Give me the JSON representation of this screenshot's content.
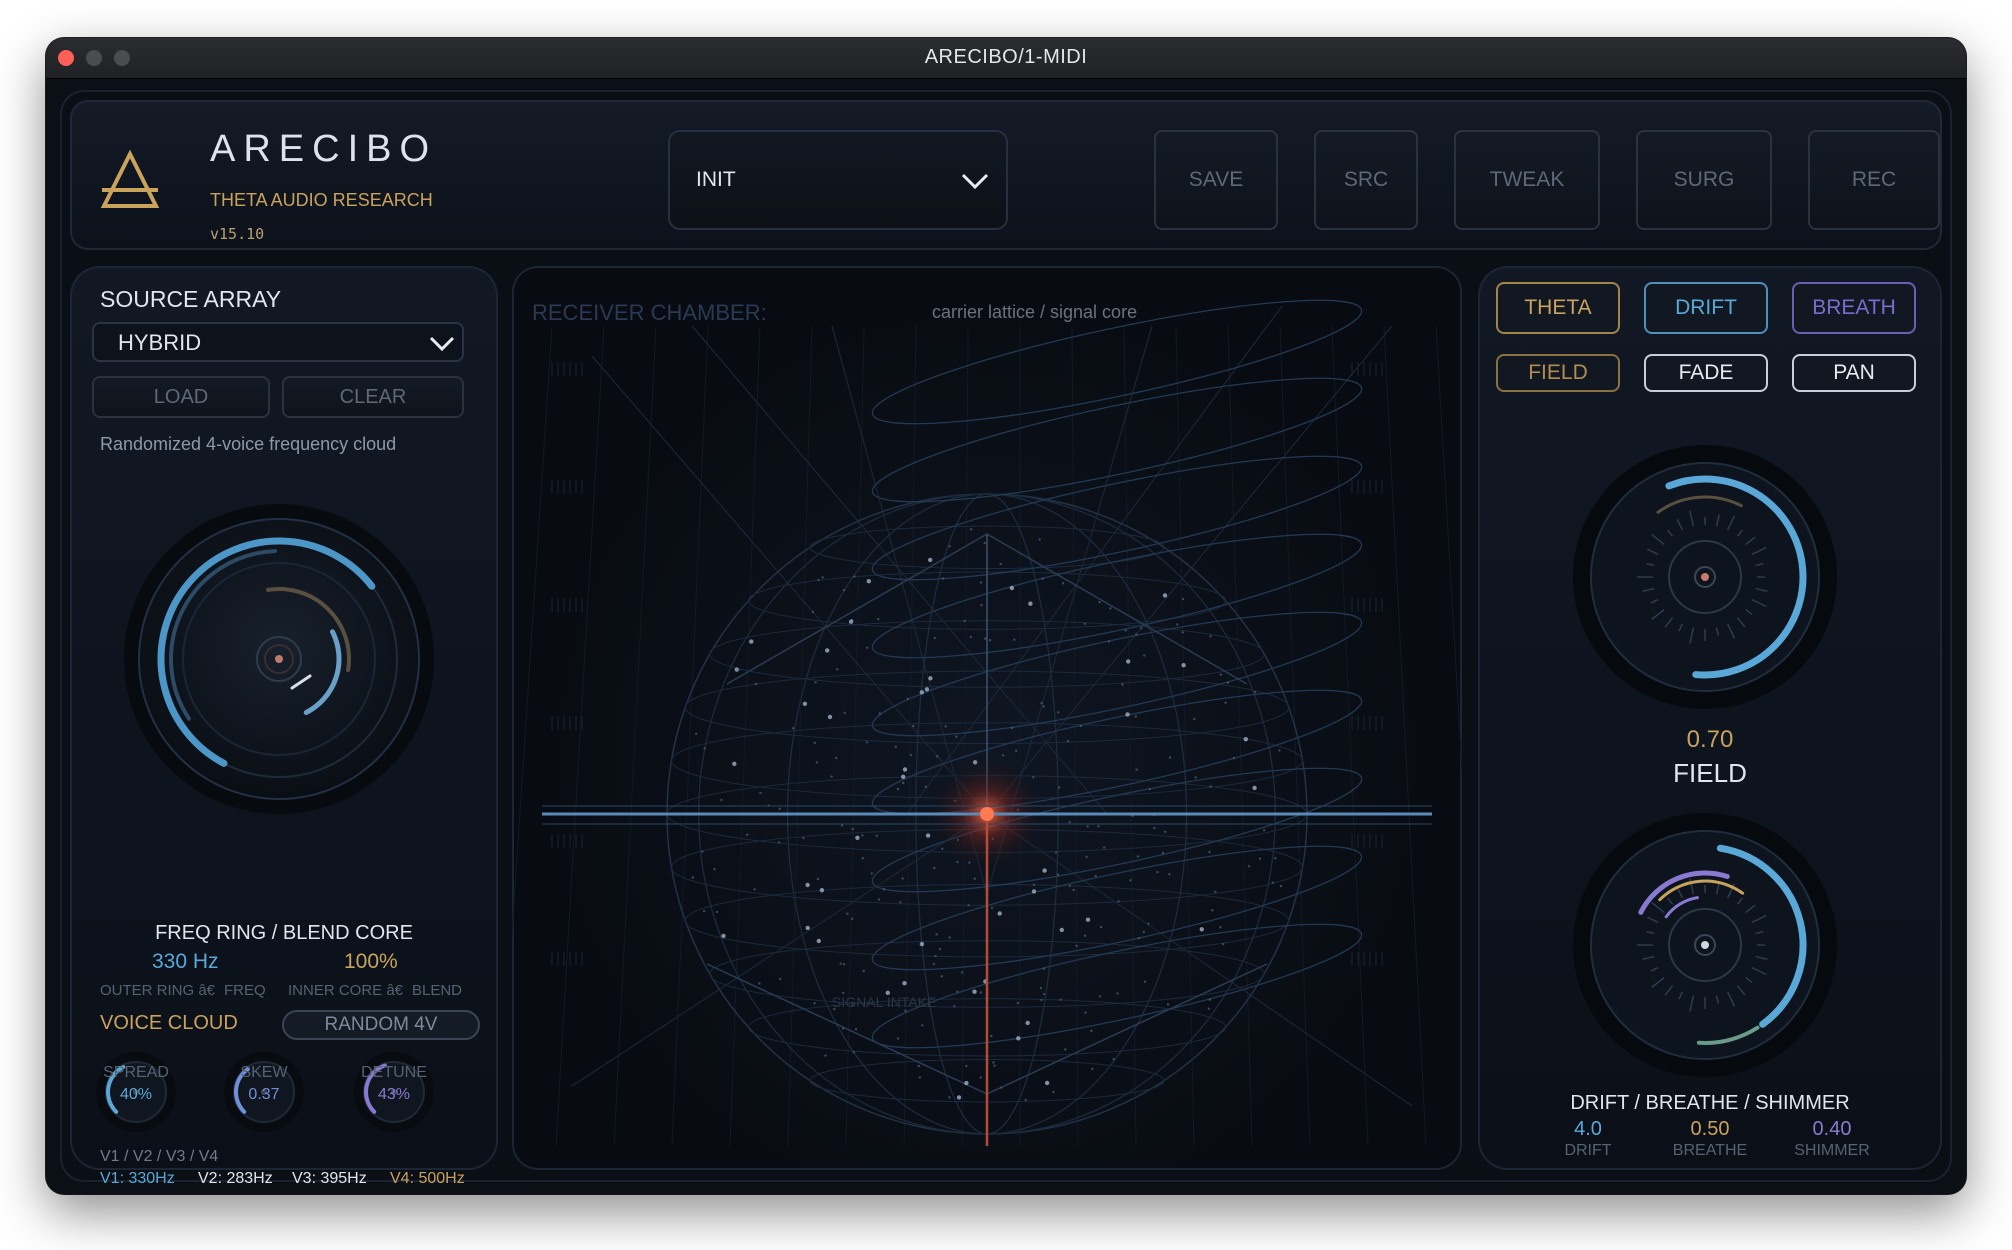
{
  "window": {
    "title": "ARECIBO/1-MIDI"
  },
  "header": {
    "brand": "ARECIBO",
    "subtitle": "THETA AUDIO RESEARCH",
    "version": "v15.10",
    "preset": "INIT",
    "buttons": [
      "SAVE",
      "SRC",
      "TWEAK",
      "SURG",
      "REC"
    ]
  },
  "source": {
    "title": "SOURCE ARRAY",
    "mode": "HYBRID",
    "load": "LOAD",
    "clear": "CLEAR",
    "description": "Randomized 4-voice frequency cloud",
    "dial_title": "FREQ RING / BLEND CORE",
    "freq_value": "330 Hz",
    "blend_value": "100%",
    "outer_label": "OUTER RING â€",
    "outer_param": "FREQ",
    "inner_label": "INNER CORE â€",
    "inner_param": "BLEND",
    "freq_level": 0.72,
    "blend_level": 1.0,
    "voice_title": "VOICE CLOUD",
    "random_button": "RANDOM 4V",
    "knobs": [
      {
        "label": "SPREAD",
        "value": "40%",
        "level": 0.4,
        "color": "#5aa8d8"
      },
      {
        "label": "SKEW",
        "value": "0.37",
        "level": 0.37,
        "color": "#6f8fd8"
      },
      {
        "label": "DETUNE",
        "value": "43%",
        "level": 0.43,
        "color": "#8a79d0"
      }
    ],
    "voices_header": "V1 / V2 / V3 / V4",
    "voices": [
      "V1: 330Hz",
      "V2: 283Hz",
      "V3: 395Hz",
      "V4: 500Hz"
    ]
  },
  "chamber": {
    "title": "RECEIVER CHAMBER:",
    "caption": "carrier lattice / signal core",
    "intake": "SIGNAL INTAKE"
  },
  "right": {
    "mode_buttons": [
      "THETA",
      "DRIFT",
      "BREATH"
    ],
    "mode_buttons2": [
      "FIELD",
      "FADE",
      "PAN"
    ],
    "field_value": "0.70",
    "field_label": "FIELD",
    "field_level": 0.7,
    "multi_title": "DRIFT / BREATHE / SHIMMER",
    "params": [
      {
        "value": "4.0",
        "label": "DRIFT"
      },
      {
        "value": "0.50",
        "label": "BREATHE"
      },
      {
        "value": "0.40",
        "label": "SHIMMER"
      }
    ]
  },
  "colors": {
    "gold": "#c9a25c",
    "blue": "#5aa8d8",
    "purple": "#8a79d0",
    "core": "#ff5a3a"
  }
}
